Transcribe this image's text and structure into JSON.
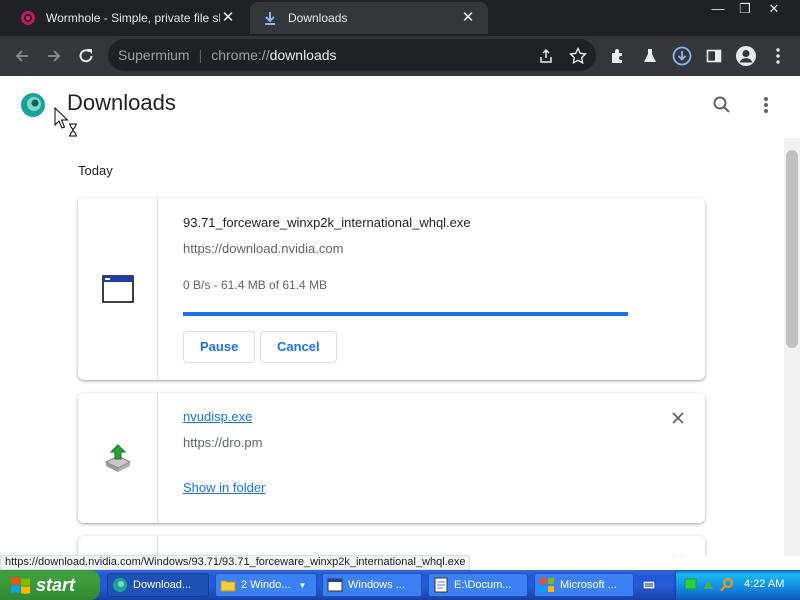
{
  "tabs": [
    {
      "title": "Wormhole - Simple, private file sharing",
      "active": false
    },
    {
      "title": "Downloads",
      "active": true
    }
  ],
  "omnibox": {
    "brand": "Supermium",
    "scheme": "chrome://",
    "host": "downloads"
  },
  "page": {
    "title": "Downloads",
    "date_heading": "Today"
  },
  "downloads": [
    {
      "filename": "93.71_forceware_winxp2k_international_whql.exe",
      "url": "https://download.nvidia.com",
      "status": "0 B/s - 61.4 MB of 61.4 MB",
      "progress": 1.0,
      "buttons": [
        "Pause",
        "Cancel"
      ]
    },
    {
      "filename": "nvudisp.exe",
      "url": "https://dro.pm",
      "action": "Show in folder"
    }
  ],
  "status_bubble": "https://download.nvidia.com/Windows/93.71/93.71_forceware_winxp2k_international_whql.exe",
  "taskbar": {
    "start_label": "start",
    "tasks": [
      "Download...",
      "2 Windo...",
      "Windows ...",
      "E:\\Docum...",
      "Microsoft ..."
    ],
    "clock": "4:22 AM"
  },
  "colors": {
    "accent": "#1a73e8",
    "tabstrip": "#202124",
    "toolbar": "#35363a"
  }
}
